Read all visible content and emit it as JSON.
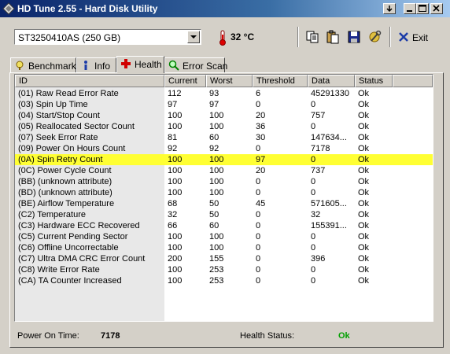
{
  "window": {
    "title": "HD Tune 2.55 - Hard Disk Utility"
  },
  "toolbar": {
    "drive": "ST3250410AS (250 GB)",
    "temperature": "32 °C",
    "exit_label": "Exit"
  },
  "tabs": [
    {
      "label": "Benchmark",
      "icon": "gauge-icon"
    },
    {
      "label": "Info",
      "icon": "info-icon"
    },
    {
      "label": "Health",
      "icon": "health-cross-icon",
      "active": true
    },
    {
      "label": "Error Scan",
      "icon": "magnifier-icon"
    }
  ],
  "table": {
    "columns": [
      "ID",
      "Current",
      "Worst",
      "Threshold",
      "Data",
      "Status"
    ],
    "highlight_row_index": 6,
    "highlight_color": "#ffff33",
    "rows": [
      [
        "(01) Raw Read Error Rate",
        "112",
        "93",
        "6",
        "45291330",
        "Ok"
      ],
      [
        "(03) Spin Up Time",
        "97",
        "97",
        "0",
        "0",
        "Ok"
      ],
      [
        "(04) Start/Stop Count",
        "100",
        "100",
        "20",
        "757",
        "Ok"
      ],
      [
        "(05) Reallocated Sector Count",
        "100",
        "100",
        "36",
        "0",
        "Ok"
      ],
      [
        "(07) Seek Error Rate",
        "81",
        "60",
        "30",
        "147634...",
        "Ok"
      ],
      [
        "(09) Power On Hours Count",
        "92",
        "92",
        "0",
        "7178",
        "Ok"
      ],
      [
        "(0A) Spin Retry Count",
        "100",
        "100",
        "97",
        "0",
        "Ok"
      ],
      [
        "(0C) Power Cycle Count",
        "100",
        "100",
        "20",
        "737",
        "Ok"
      ],
      [
        "(BB) (unknown attribute)",
        "100",
        "100",
        "0",
        "0",
        "Ok"
      ],
      [
        "(BD) (unknown attribute)",
        "100",
        "100",
        "0",
        "0",
        "Ok"
      ],
      [
        "(BE) Airflow Temperature",
        "68",
        "50",
        "45",
        "571605...",
        "Ok"
      ],
      [
        "(C2) Temperature",
        "32",
        "50",
        "0",
        "32",
        "Ok"
      ],
      [
        "(C3) Hardware ECC Recovered",
        "66",
        "60",
        "0",
        "155391...",
        "Ok"
      ],
      [
        "(C5) Current Pending Sector",
        "100",
        "100",
        "0",
        "0",
        "Ok"
      ],
      [
        "(C6) Offline Uncorrectable",
        "100",
        "100",
        "0",
        "0",
        "Ok"
      ],
      [
        "(C7) Ultra DMA CRC Error Count",
        "200",
        "155",
        "0",
        "396",
        "Ok"
      ],
      [
        "(C8) Write Error Rate",
        "100",
        "253",
        "0",
        "0",
        "Ok"
      ],
      [
        "(CA) TA Counter Increased",
        "100",
        "253",
        "0",
        "0",
        "Ok"
      ]
    ]
  },
  "status": {
    "power_on_label": "Power On Time:",
    "power_on_value": "7178",
    "health_label": "Health Status:",
    "health_value": "Ok",
    "health_color": "#00a000"
  }
}
